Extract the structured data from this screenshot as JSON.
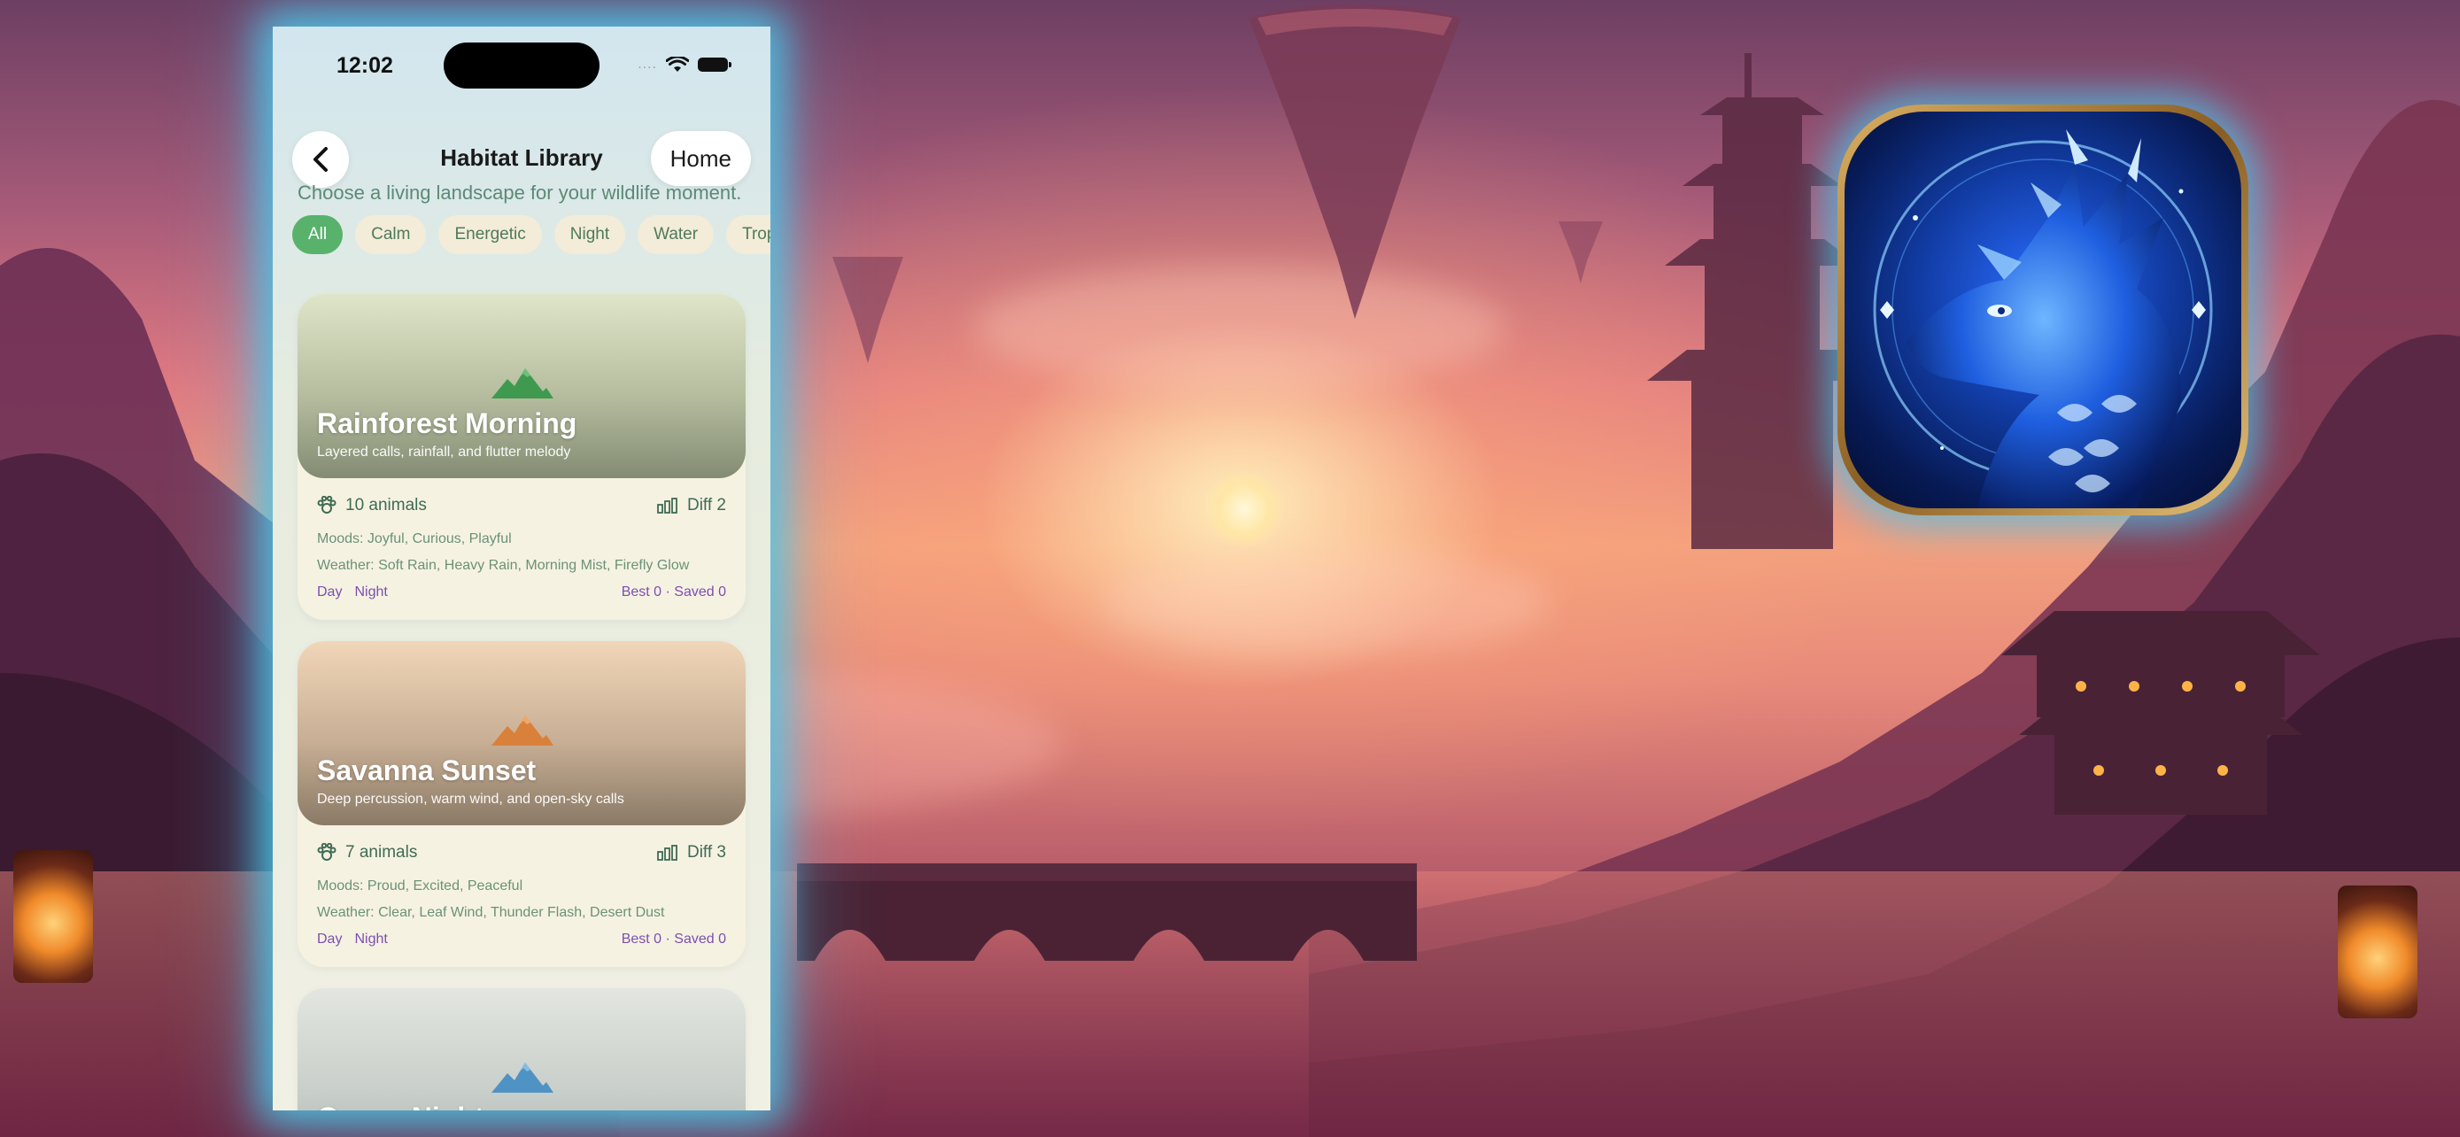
{
  "status_bar": {
    "time": "12:02",
    "signal": "....",
    "wifi_icon": "wifi-icon",
    "battery_icon": "battery-icon"
  },
  "nav": {
    "title": "Habitat Library",
    "home_label": "Home",
    "back_icon": "chevron-left-icon"
  },
  "subtitle": "Choose a living landscape for your wildlife moment.",
  "filters": {
    "active": "All",
    "items": [
      "All",
      "Calm",
      "Energetic",
      "Night",
      "Water",
      "Tropical"
    ]
  },
  "cards": [
    {
      "title": "Rainforest Morning",
      "description": "Layered calls, rainfall, and flutter melody",
      "animals": "10 animals",
      "difficulty": "Diff 2",
      "moods": "Moods: Joyful, Curious, Playful",
      "weather": "Weather: Soft Rain, Heavy Rain, Morning Mist, Firefly Glow",
      "tag_day": "Day",
      "tag_night": "Night",
      "stats": "Best 0 · Saved 0",
      "hero_top": "#dfe5c8",
      "hero_bottom": "#838c73",
      "icon_color": "#3f9a4f"
    },
    {
      "title": "Savanna Sunset",
      "description": "Deep percussion, warm wind, and open-sky calls",
      "animals": "7 animals",
      "difficulty": "Diff 3",
      "moods": "Moods: Proud, Excited, Peaceful",
      "weather": "Weather: Clear, Leaf Wind, Thunder Flash, Desert Dust",
      "tag_day": "Day",
      "tag_night": "Night",
      "stats": "Best 0 · Saved 0",
      "hero_top": "#f1d6b8",
      "hero_bottom": "#8a7a66",
      "icon_color": "#d9803a"
    },
    {
      "title": "Ocean Night",
      "hero_top": "#e3e6e1",
      "hero_bottom": "#aab2ad",
      "icon_color": "#4f93c4"
    }
  ],
  "colors": {
    "accent": "#58b26c",
    "glow": "#4ac8eb",
    "tag_purple": "#7c4fb0",
    "muted_green": "#5b8a74"
  },
  "app_icon": {
    "icon": "dragon-app-icon"
  }
}
